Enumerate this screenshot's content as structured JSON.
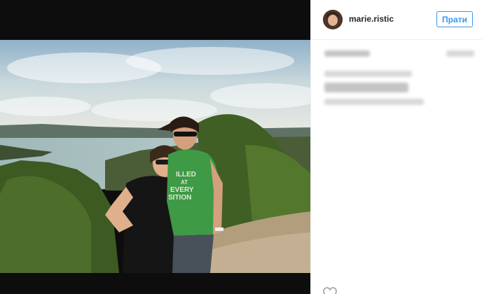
{
  "post": {
    "username": "marie.ristic",
    "follow_label": "Прати"
  },
  "icons": {
    "avatar": "avatar",
    "like": "heart-icon"
  },
  "colors": {
    "accent": "#3897f0",
    "photo_background": "#0d0d0d"
  }
}
